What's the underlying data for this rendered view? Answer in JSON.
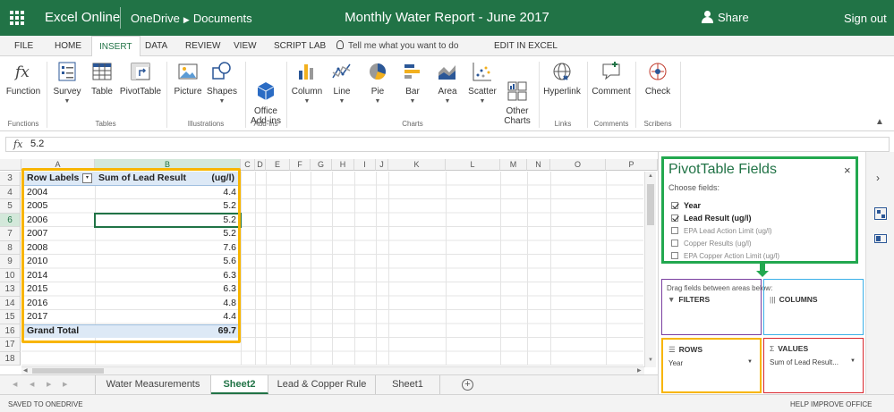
{
  "titlebar": {
    "app_name": "Excel Online",
    "breadcrumb": [
      "OneDrive",
      "Documents"
    ],
    "doc_title": "Monthly Water Report - June 2017",
    "share_label": "Share",
    "signout_label": "Sign out"
  },
  "menu_tabs": [
    {
      "label": "FILE"
    },
    {
      "label": "HOME"
    },
    {
      "label": "INSERT"
    },
    {
      "label": "DATA"
    },
    {
      "label": "REVIEW"
    },
    {
      "label": "VIEW"
    },
    {
      "label": "SCRIPT LAB"
    }
  ],
  "active_tab": "INSERT",
  "tell_me": "Tell me what you want to do",
  "edit_in_excel": "EDIT IN EXCEL",
  "ribbon": {
    "buttons": [
      {
        "label": "Function",
        "icon": "function-icon"
      },
      {
        "label": "Survey",
        "icon": "survey-icon"
      },
      {
        "label": "Table",
        "icon": "table-icon"
      },
      {
        "label": "PivotTable",
        "icon": "pivottable-icon"
      },
      {
        "label": "Picture",
        "icon": "picture-icon"
      },
      {
        "label": "Shapes",
        "icon": "shapes-icon"
      },
      {
        "label": "Office\nAdd-ins",
        "icon": "office-addins-icon"
      },
      {
        "label": "Column",
        "icon": "column-chart-icon"
      },
      {
        "label": "Line",
        "icon": "line-chart-icon"
      },
      {
        "label": "Pie",
        "icon": "pie-chart-icon"
      },
      {
        "label": "Bar",
        "icon": "bar-chart-icon"
      },
      {
        "label": "Area",
        "icon": "area-chart-icon"
      },
      {
        "label": "Scatter",
        "icon": "scatter-chart-icon"
      },
      {
        "label": "Other\nCharts",
        "icon": "other-charts-icon"
      },
      {
        "label": "Hyperlink",
        "icon": "hyperlink-icon"
      },
      {
        "label": "Comment",
        "icon": "comment-icon"
      },
      {
        "label": "Check",
        "icon": "check-icon"
      }
    ],
    "groups": [
      {
        "label": "Functions"
      },
      {
        "label": "Tables"
      },
      {
        "label": "Illustrations"
      },
      {
        "label": "Add-ins"
      },
      {
        "label": "Charts"
      },
      {
        "label": "Links"
      },
      {
        "label": "Comments"
      },
      {
        "label": "Scribens"
      }
    ]
  },
  "formula_bar": {
    "fx": "fx",
    "value": "5.2"
  },
  "columns": [
    "A",
    "B",
    "C",
    "D",
    "E",
    "F",
    "G",
    "H",
    "I",
    "J",
    "K",
    "L",
    "M",
    "N",
    "O",
    "P"
  ],
  "selected_column": "B",
  "selected_row": "6",
  "rows": [
    "3",
    "4",
    "5",
    "6",
    "7",
    "8",
    "9",
    "10",
    "13",
    "14",
    "15",
    "16",
    "17",
    "18",
    "19"
  ],
  "pivot": {
    "header_rows": "Row Labels",
    "header_values": "Sum of Lead Result",
    "header_unit": "(ug/l)",
    "filter_glyph": "▾",
    "items": [
      {
        "label": "2004",
        "value": "4.4"
      },
      {
        "label": "2005",
        "value": "5.2"
      },
      {
        "label": "2006",
        "value": "5.2"
      },
      {
        "label": "2007",
        "value": "5.2"
      },
      {
        "label": "2008",
        "value": "7.6"
      },
      {
        "label": "2010",
        "value": "5.6"
      },
      {
        "label": "2014",
        "value": "6.3"
      },
      {
        "label": "2015",
        "value": "6.3"
      },
      {
        "label": "2016",
        "value": "4.8"
      },
      {
        "label": "2017",
        "value": "4.4"
      }
    ],
    "total_label": "Grand Total",
    "total_value": "69.7"
  },
  "sheets": [
    {
      "label": "Water Measurements"
    },
    {
      "label": "Sheet2"
    },
    {
      "label": "Lead & Copper Rule"
    },
    {
      "label": "Sheet1"
    }
  ],
  "active_sheet": "Sheet2",
  "add_sheet": "+",
  "status": {
    "saved": "SAVED TO ONEDRIVE",
    "help": "HELP IMPROVE OFFICE"
  },
  "pivot_pane": {
    "title": "PivotTable Fields",
    "close": "×",
    "choose": "Choose fields:",
    "fields": [
      {
        "label": "Year",
        "checked": true
      },
      {
        "label": "Lead Result (ug/l)",
        "checked": true
      },
      {
        "label": "EPA Lead Action Limit (ug/l)",
        "checked": false
      },
      {
        "label": "Copper Results (ug/l)",
        "checked": false
      },
      {
        "label": "EPA Copper Action Limit (ug/l)",
        "checked": false
      }
    ],
    "drag_text": "Drag fields between areas below:",
    "areas": {
      "filters": {
        "label": "FILTERS",
        "icon": "filter-icon"
      },
      "columns": {
        "label": "COLUMNS",
        "icon": "columns-icon"
      },
      "rows": {
        "label": "ROWS",
        "icon": "rows-icon",
        "value": "Year"
      },
      "values": {
        "label": "VALUES",
        "icon": "sigma-icon",
        "value": "Sum of Lead Result..."
      }
    }
  },
  "colors": {
    "brand": "#217346",
    "highlight_yellow": "#f8b500",
    "highlight_green": "#22a84f",
    "area_columns": "#3bb0e8",
    "area_filters": "#7b3fa0",
    "area_rows": "#f8b500",
    "area_values": "#d9272e",
    "pivot_header": "#dde9f6"
  }
}
